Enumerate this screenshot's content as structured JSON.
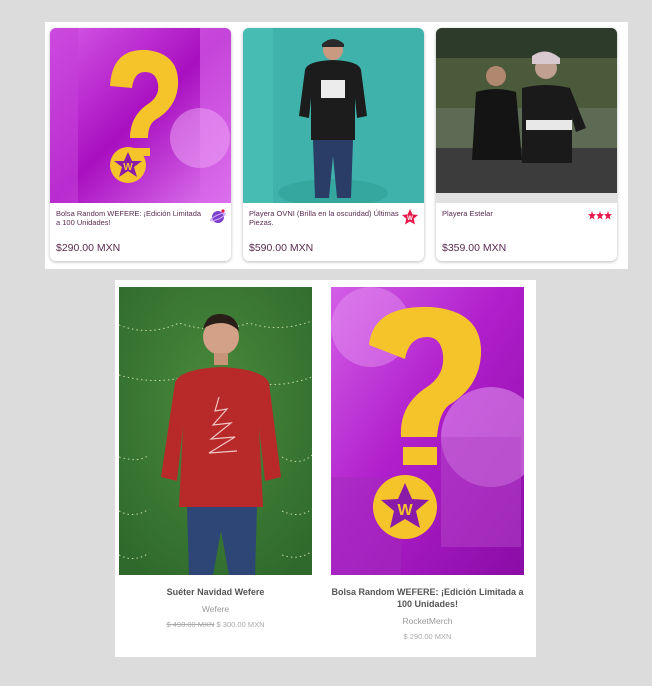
{
  "top_products": [
    {
      "title": "Bolsa Random WEFERE: ¡Edición Limitada a 100 Unidades!",
      "price": "$290.00 MXN",
      "badge_icon": "planet-icon"
    },
    {
      "title": "Playera OVNI (Brilla en la oscuridad) Últimas Piezas.",
      "price": "$590.00 MXN",
      "badge_icon": "star-icon"
    },
    {
      "title": "Playera Estelar",
      "price": "$359.00 MXN",
      "badge_icon": "three-stars-icon"
    }
  ],
  "bottom_products": [
    {
      "title": "Suéter Navidad Wefere",
      "vendor": "Wefere",
      "compare_price": "$ 490.00 MXN",
      "price": "$ 300.00 MXN"
    },
    {
      "title": "Bolsa Random WEFERE: ¡Edición Limitada a 100 Unidades!",
      "vendor": "RocketMerch",
      "price": "$ 290.00 MXN"
    }
  ],
  "colors": {
    "text_primary": "#5a2a52",
    "magenta": "#c21ad6",
    "teal": "#3fb3ab",
    "yellow": "#f5c42a",
    "badge_pink": "#e5194d"
  }
}
